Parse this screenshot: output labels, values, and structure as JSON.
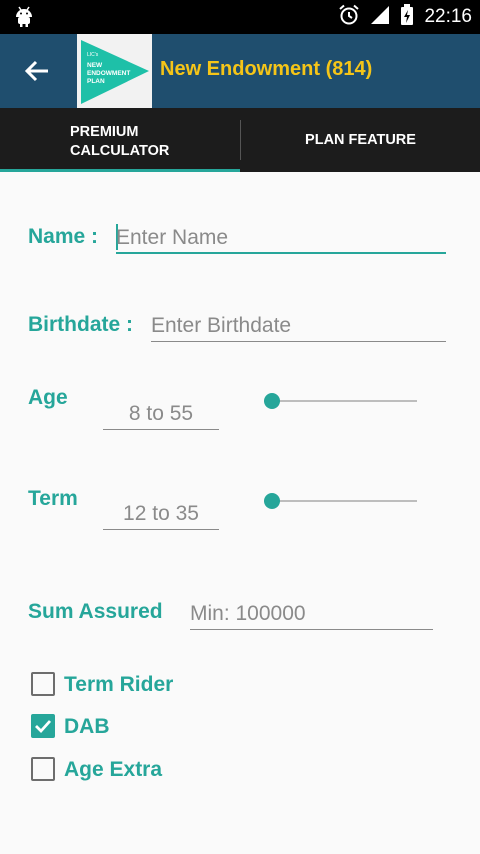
{
  "status_bar": {
    "time": "22:16",
    "icons": [
      "android-icon",
      "alarm-clock-icon",
      "signal-icon",
      "battery-charging-icon"
    ]
  },
  "app_bar": {
    "title": "New Endowment (814)",
    "logo_text": [
      "NEW",
      "ENDOWMENT",
      "PLAN"
    ],
    "logo_tag": "LIC's"
  },
  "tabs": [
    {
      "label": "PREMIUM CALCULATOR",
      "lines": [
        "PREMIUM",
        "CALCULATOR"
      ],
      "selected": true
    },
    {
      "label": "PLAN FEATURE",
      "selected": false
    }
  ],
  "form": {
    "name": {
      "label": "Name :",
      "placeholder": "Enter Name"
    },
    "birthdate": {
      "label": "Birthdate :",
      "placeholder": "Enter Birthdate"
    },
    "age": {
      "label": "Age",
      "placeholder": "8 to 55",
      "slider_value": 0
    },
    "term": {
      "label": "Term",
      "placeholder": "12 to 35",
      "slider_value": 0
    },
    "sum_assured": {
      "label": "Sum Assured",
      "placeholder": "Min: 100000"
    },
    "checkboxes": [
      {
        "label": "Term Rider",
        "checked": false
      },
      {
        "label": "DAB",
        "checked": true
      },
      {
        "label": "Age Extra",
        "checked": false
      }
    ]
  },
  "colors": {
    "accent": "#26a69a",
    "app_bar": "#1f4e6e",
    "title": "#f5c518",
    "tabs": "#1c1c1c"
  }
}
